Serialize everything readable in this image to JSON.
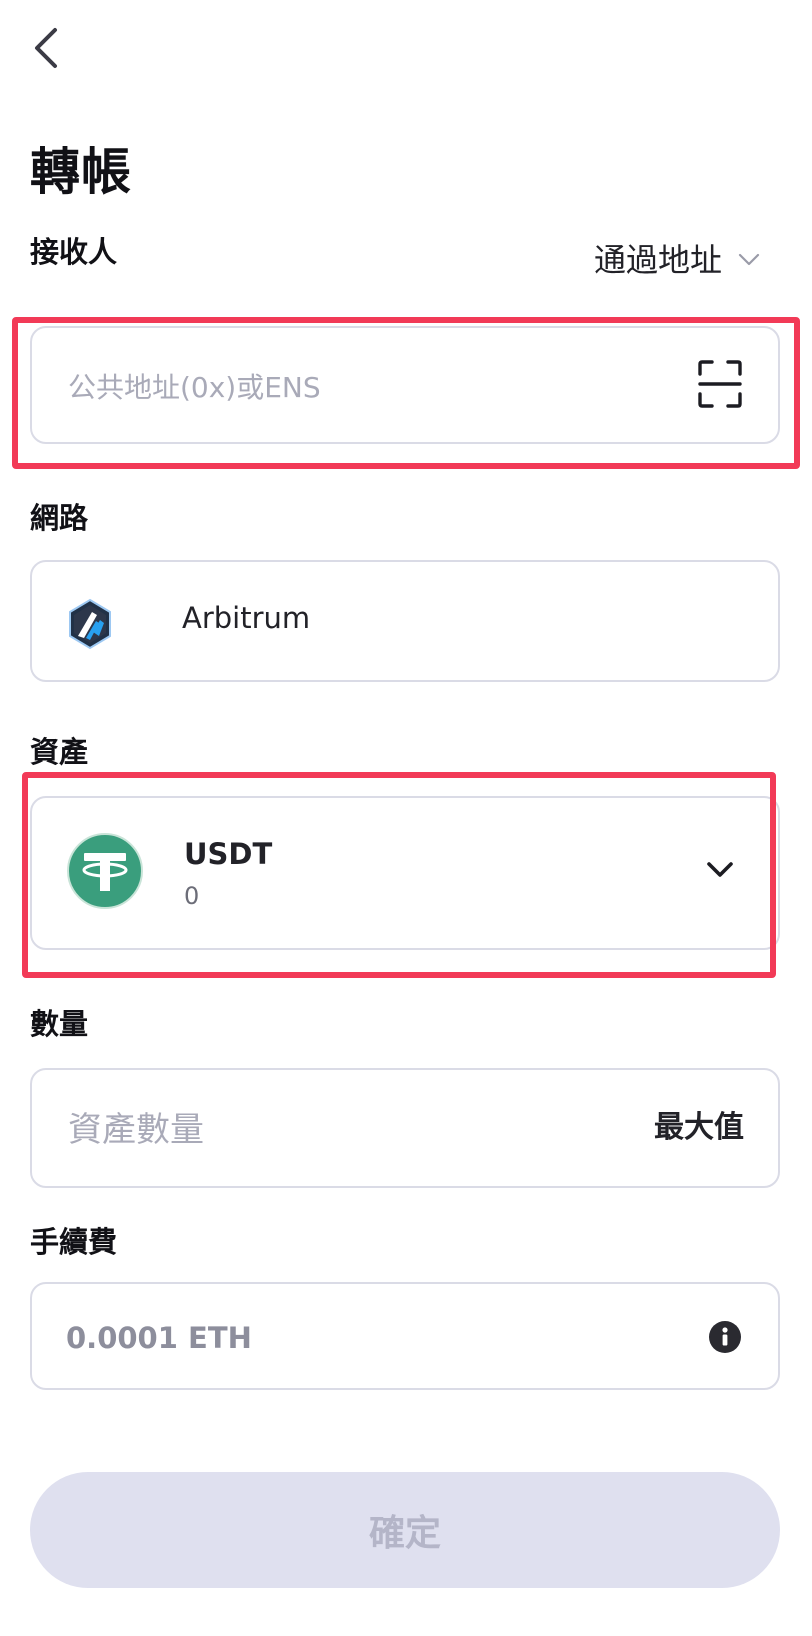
{
  "header": {
    "title": "轉帳"
  },
  "recipient": {
    "label": "接收人",
    "mode": "通過地址",
    "placeholder": "公共地址(0x)或ENS"
  },
  "network": {
    "label": "網路",
    "name": "Arbitrum"
  },
  "asset": {
    "label": "資產",
    "symbol": "USDT",
    "balance": "0",
    "logo_letter": "T"
  },
  "amount": {
    "label": "數量",
    "placeholder": "資產數量",
    "max_label": "最大值"
  },
  "fee": {
    "label": "手續費",
    "value": "0.0001 ETH"
  },
  "confirm": {
    "label": "確定"
  },
  "colors": {
    "highlight": "#f23a57",
    "tether_green": "#3a9e7d",
    "arbitrum_blue": "#2d7fe0",
    "disabled_button": "#dfe0ef"
  }
}
